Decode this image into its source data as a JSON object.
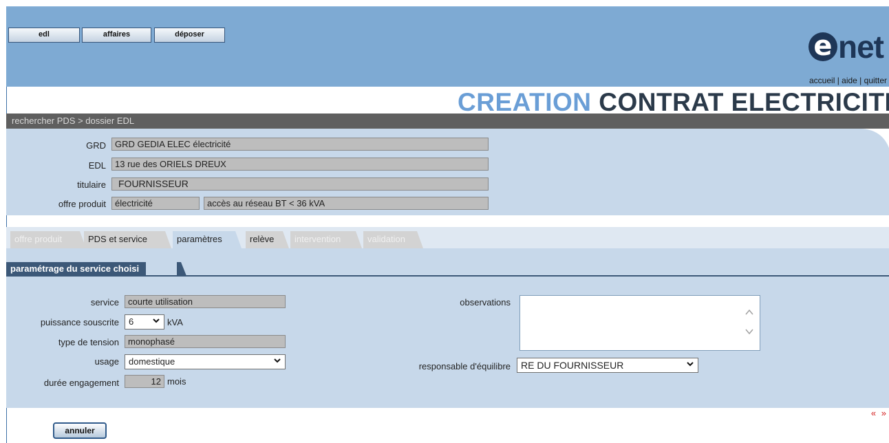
{
  "nav": {
    "buttons": [
      "edl",
      "affaires",
      "déposer"
    ]
  },
  "logo": {
    "letter": "e",
    "text": "net"
  },
  "toplinks": {
    "accueil": "accueil",
    "sep": " | ",
    "aide": "aide",
    "quitter": "quitter"
  },
  "title": {
    "part1": "CREATION",
    "part2": "CONTRAT ELECTRICITE"
  },
  "breadcrumb": {
    "text": "rechercher PDS > dossier EDL"
  },
  "info": {
    "grd_label": "GRD",
    "grd_value": "GRD GEDIA ELEC électricité",
    "edl_label": "EDL",
    "edl_value": "13 rue des ORIELS DREUX",
    "titulaire_label": "titulaire",
    "titulaire_value": "FOURNISSEUR",
    "offre_label": "offre produit",
    "offre_value1": "électricité",
    "offre_value2": "accès au réseau BT < 36 kVA"
  },
  "tabs": [
    {
      "label": "offre produit",
      "state": "disabled"
    },
    {
      "label": "PDS et service",
      "state": "normal"
    },
    {
      "label": "paramètres",
      "state": "active"
    },
    {
      "label": "relève",
      "state": "normal"
    },
    {
      "label": "intervention",
      "state": "disabled"
    },
    {
      "label": "validation",
      "state": "disabled"
    }
  ],
  "section": {
    "title": "paramétrage du service choisi"
  },
  "form": {
    "service_label": "service",
    "service_value": "courte utilisation",
    "puissance_label": "puissance souscrite",
    "puissance_value": "6",
    "puissance_unit": "kVA",
    "tension_label": "type de tension",
    "tension_value": "monophasé",
    "usage_label": "usage",
    "usage_value": "domestique",
    "duree_label": "durée engagement",
    "duree_value": "12",
    "duree_unit": "mois",
    "observations_label": "observations",
    "observations_value": "",
    "responsable_label": "responsable d'équilibre",
    "responsable_value": "RE DU FOURNISSEUR"
  },
  "actions": {
    "annuler": "annuler"
  },
  "pager": {
    "text": "« »"
  },
  "colors": {
    "header": "#7eaad3",
    "panel": "#c7d8ea",
    "dark": "#3c5878",
    "title_accent": "#6a9ed6",
    "title_dark": "#2b3a4a",
    "pager": "#d21c1c"
  }
}
